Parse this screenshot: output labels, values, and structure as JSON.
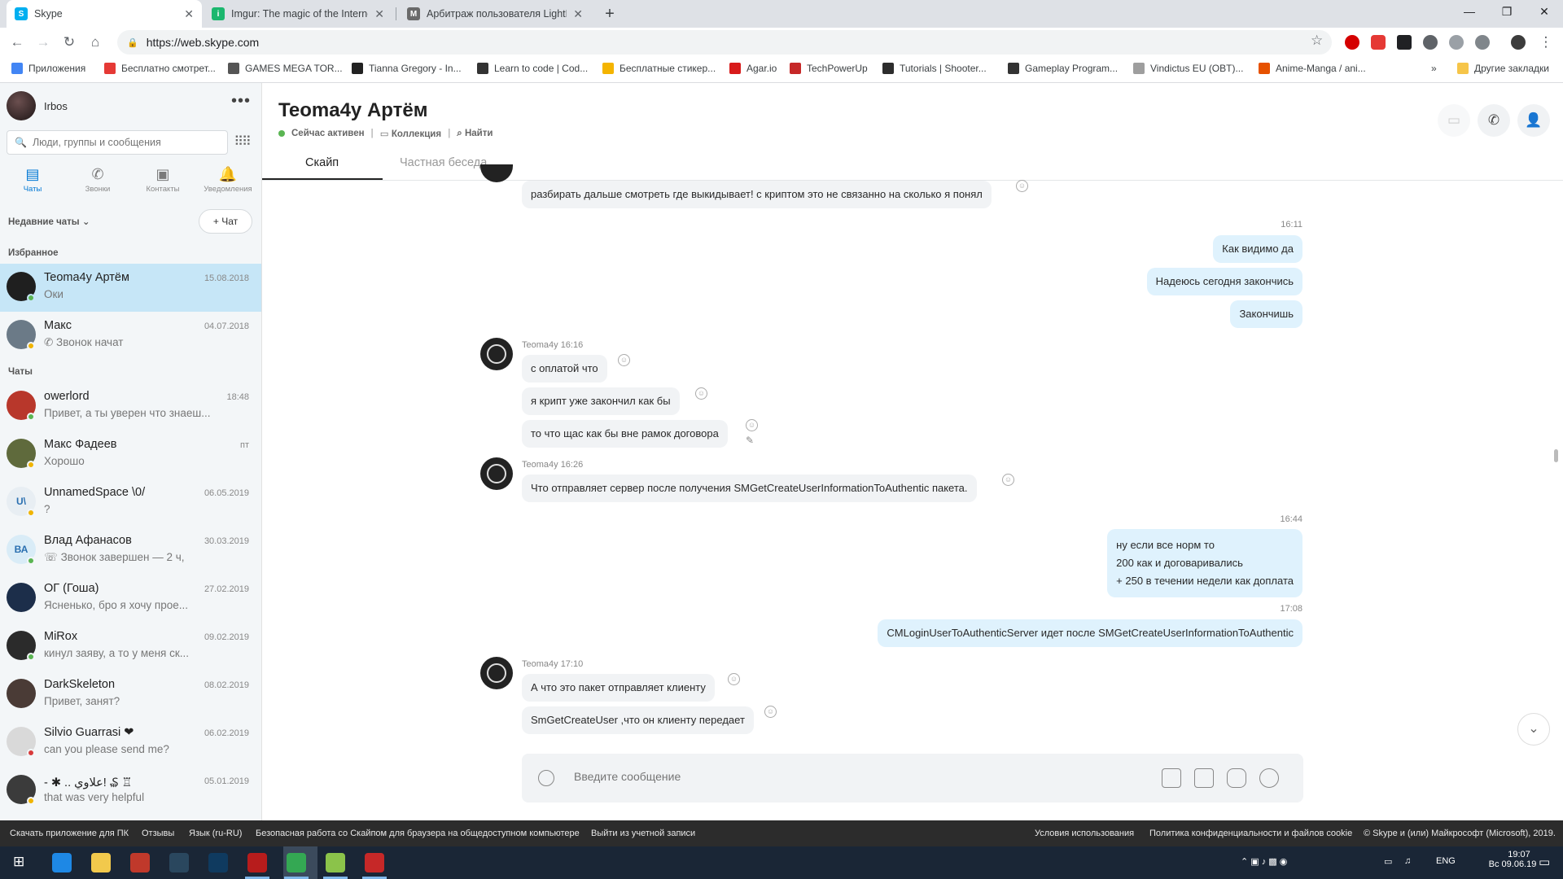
{
  "browser": {
    "tabs": [
      {
        "title": "Skype",
        "favicon_color": "#00aff0",
        "favicon_glyph": "S"
      },
      {
        "title": "Imgur: The magic of the Internet",
        "favicon_color": "#1bb76e",
        "favicon_glyph": "i"
      },
      {
        "title": "Арбитраж пользователя LightF",
        "favicon_color": "#6a6a6a",
        "favicon_glyph": "M"
      }
    ],
    "url": "https://web.skype.com",
    "bookmarks": [
      {
        "label": "Приложения",
        "color": "#4285f4"
      },
      {
        "label": "Бесплатно смотрет...",
        "color": "#e53935"
      },
      {
        "label": "GAMES MEGA TOR...",
        "color": "#555555"
      },
      {
        "label": "Tianna Gregory - In...",
        "color": "#222222"
      },
      {
        "label": "Learn to code | Cod...",
        "color": "#333333"
      },
      {
        "label": "Бесплатные стикер...",
        "color": "#f4b400"
      },
      {
        "label": "Agar.io",
        "color": "#d81b1b"
      },
      {
        "label": "TechPowerUp",
        "color": "#c62828"
      },
      {
        "label": "Tutorials | Shooter...",
        "color": "#2d2d2d"
      },
      {
        "label": "Gameplay Program...",
        "color": "#333333"
      },
      {
        "label": "Vindictus EU (OBT)...",
        "color": "#9e9e9e"
      },
      {
        "label": "Anime-Manga / ani...",
        "color": "#e65100"
      }
    ],
    "bookmarks_overflow": "»",
    "other_bookmarks": "Другие закладки"
  },
  "sidebar": {
    "user_name": "Irbos",
    "search_placeholder": "Люди, группы и сообщения",
    "nav": [
      {
        "label": "Чаты",
        "icon": "chat-icon"
      },
      {
        "label": "Звонки",
        "icon": "phone-icon"
      },
      {
        "label": "Контакты",
        "icon": "contacts-icon"
      },
      {
        "label": "Уведомления",
        "icon": "bell-icon"
      }
    ],
    "recent_label": "Недавние чаты",
    "new_chat_label": "+ Чат",
    "favorites_label": "Избранное",
    "chats_label": "Чаты",
    "favorites": [
      {
        "name": "Teoma4y Артём",
        "preview": "Оки",
        "date": "15.08.2018",
        "status": "#5ab552",
        "avatar_color": "#1f1f1f",
        "avatar_text": ""
      },
      {
        "name": "Макс",
        "preview": "✆ Звонок начат",
        "date": "04.07.2018",
        "status": "#f0b400",
        "avatar_color": "#6b7a87",
        "avatar_text": ""
      }
    ],
    "chats": [
      {
        "name": "owerlord",
        "preview": "Привет, а ты уверен что знаеш...",
        "date": "18:48",
        "status": "#5ab552",
        "avatar_color": "#b8372b",
        "avatar_text": ""
      },
      {
        "name": "Макс Фадеев",
        "preview": "Хорошо",
        "date": "пт",
        "status": "#f0b400",
        "avatar_color": "#5f6a3c",
        "avatar_text": ""
      },
      {
        "name": "UnnamedSpace \\0/",
        "preview": "?",
        "date": "06.05.2019",
        "status": "#f0b400",
        "avatar_color": "#e8eef3",
        "avatar_text": "U\\"
      },
      {
        "name": "Влад Афанасов",
        "preview": "☏ Звонок завершен — 2 ч,",
        "date": "30.03.2019",
        "status": "#5ab552",
        "avatar_color": "#d9ecf7",
        "avatar_text": "ВА"
      },
      {
        "name": "ОГ (Гоша)",
        "preview": "Ясненько, бро я хочу прое...",
        "date": "27.02.2019",
        "status": "",
        "avatar_color": "#1c2e4a",
        "avatar_text": ""
      },
      {
        "name": "MiRox",
        "preview": "кинул заяву, а то у меня ск...",
        "date": "09.02.2019",
        "status": "#5ab552",
        "avatar_color": "#2b2b2b",
        "avatar_text": ""
      },
      {
        "name": "DarkSkeleton",
        "preview": "Привет, занят?",
        "date": "08.02.2019",
        "status": "",
        "avatar_color": "#4a3b36",
        "avatar_text": ""
      },
      {
        "name": "Silvio Guarrasi ❤",
        "preview": "can you please send me?",
        "date": "06.02.2019",
        "status": "#d83b3b",
        "avatar_color": "#d9d9d9",
        "avatar_text": ""
      },
      {
        "name": "- ✱ .. علاوي! ₷ ♖",
        "preview": "that was very helpful",
        "date": "05.01.2019",
        "status": "#f0b400",
        "avatar_color": "#3b3b3b",
        "avatar_text": ""
      }
    ]
  },
  "conversation": {
    "title": "Teoma4y Артём",
    "status": "Сейчас активен",
    "collection": "Коллекция",
    "find": "Найти",
    "tabs": [
      "Скайп",
      "Частная беседа"
    ],
    "messages": {
      "m0": "разбирать дальше смотреть где выкидывает! с криптом это не связанно на сколько я понял",
      "t1": "16:11",
      "m1": "Как видимо да",
      "m2": "Надеюсь сегодня закончись",
      "m3": "Закончишь",
      "h1": "Teoma4y 16:16",
      "m4": "с оплатой что",
      "m5": "я крипт уже закончил как бы",
      "m6": "то что щас как бы вне рамок договора",
      "h2": "Teoma4y 16:26",
      "m7": "Что отправляет сервер после получения SMGetCreateUserInformationToAuthentic  пакета.",
      "t2": "16:44",
      "m8a": "ну если все норм то",
      "m8b": "200 как и договаривались",
      "m8c": "+ 250 в течении недели как доплата",
      "t3": "17:08",
      "m9": "CMLoginUserToAuthenticServer идет после SMGetCreateUserInformationToAuthentic",
      "h3": "Teoma4y 17:10",
      "m10": "А что это пакет отправляет клиенту",
      "m11": "SmGetCreateUser ,что он клиенту передает"
    },
    "composer_placeholder": "Введите сообщение"
  },
  "footer": {
    "left": [
      "Скачать приложение для ПК",
      "Отзывы",
      "Язык (ru-RU)",
      "Безопасная работа со Скайпом для браузера на общедоступном компьютере",
      "Выйти из учетной записи"
    ],
    "right": [
      "Условия использования",
      "Политика конфиденциальности и файлов cookie",
      "© Skype и (или) Майкрософт (Microsoft), 2019."
    ]
  },
  "taskbar": {
    "lang": "ENG",
    "time": "19:07",
    "date": "Вс 09.06.19",
    "apps": [
      {
        "name": "edge",
        "color": "#1e88e5"
      },
      {
        "name": "explorer",
        "color": "#f2c94c"
      },
      {
        "name": "outlook-like",
        "color": "#c0392b"
      },
      {
        "name": "steam",
        "color": "#2a475e"
      },
      {
        "name": "app-dark",
        "color": "#0f3a5f"
      },
      {
        "name": "game",
        "color": "#b71c1c"
      },
      {
        "name": "chrome",
        "color": "#34a853"
      },
      {
        "name": "notepad",
        "color": "#8bc34a"
      },
      {
        "name": "jetbrains",
        "color": "#c62828"
      }
    ]
  }
}
